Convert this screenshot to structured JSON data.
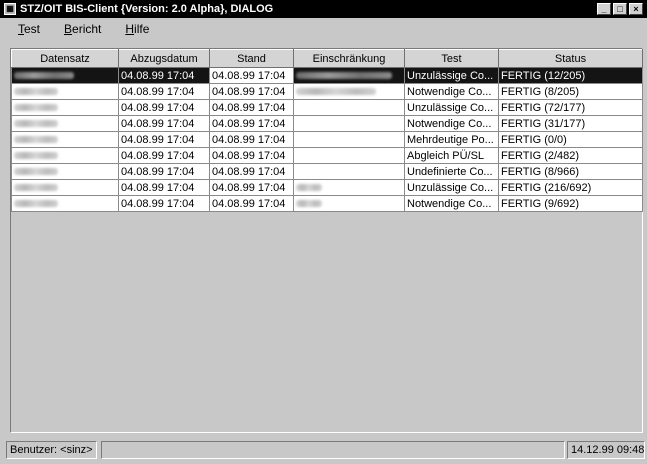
{
  "window": {
    "title": "STZ/OIT BIS-Client {Version:  2.0 Alpha}, DIALOG",
    "minimize_glyph": "_",
    "maximize_glyph": "□",
    "close_glyph": "×"
  },
  "menu": [
    {
      "label": "Test"
    },
    {
      "label": "Bericht"
    },
    {
      "label": "Hilfe"
    }
  ],
  "table": {
    "columns": [
      "Datensatz",
      "Abzugsdatum",
      "Stand",
      "Einschränkung",
      "Test",
      "Status"
    ],
    "rows": [
      {
        "abzugsdatum": "04.08.99 17:04",
        "stand": "04.08.99 17:04",
        "test": "Unzulässige Co...",
        "status": "FERTIG (12/205)",
        "selected": true
      },
      {
        "abzugsdatum": "04.08.99 17:04",
        "stand": "04.08.99 17:04",
        "test": "Notwendige Co...",
        "status": "FERTIG (8/205)"
      },
      {
        "abzugsdatum": "04.08.99 17:04",
        "stand": "04.08.99 17:04",
        "test": "Unzulässige Co...",
        "status": "FERTIG (72/177)"
      },
      {
        "abzugsdatum": "04.08.99 17:04",
        "stand": "04.08.99 17:04",
        "test": "Notwendige Co...",
        "status": "FERTIG (31/177)"
      },
      {
        "abzugsdatum": "04.08.99 17:04",
        "stand": "04.08.99 17:04",
        "test": "Mehrdeutige Po...",
        "status": "FERTIG (0/0)"
      },
      {
        "abzugsdatum": "04.08.99 17:04",
        "stand": "04.08.99 17:04",
        "test": "Abgleich PÜ/SL",
        "status": "FERTIG (2/482)"
      },
      {
        "abzugsdatum": "04.08.99 17:04",
        "stand": "04.08.99 17:04",
        "test": "Undefinierte Co...",
        "status": "FERTIG (8/966)"
      },
      {
        "abzugsdatum": "04.08.99 17:04",
        "stand": "04.08.99 17:04",
        "test": "Unzulässige Co...",
        "status": "FERTIG (216/692)"
      },
      {
        "abzugsdatum": "04.08.99 17:04",
        "stand": "04.08.99 17:04",
        "test": "Notwendige Co...",
        "status": "FERTIG (9/692)"
      }
    ]
  },
  "statusbar": {
    "user": "Benutzer: <sinz>",
    "message": "",
    "datetime": "14.12.99 09:48"
  }
}
